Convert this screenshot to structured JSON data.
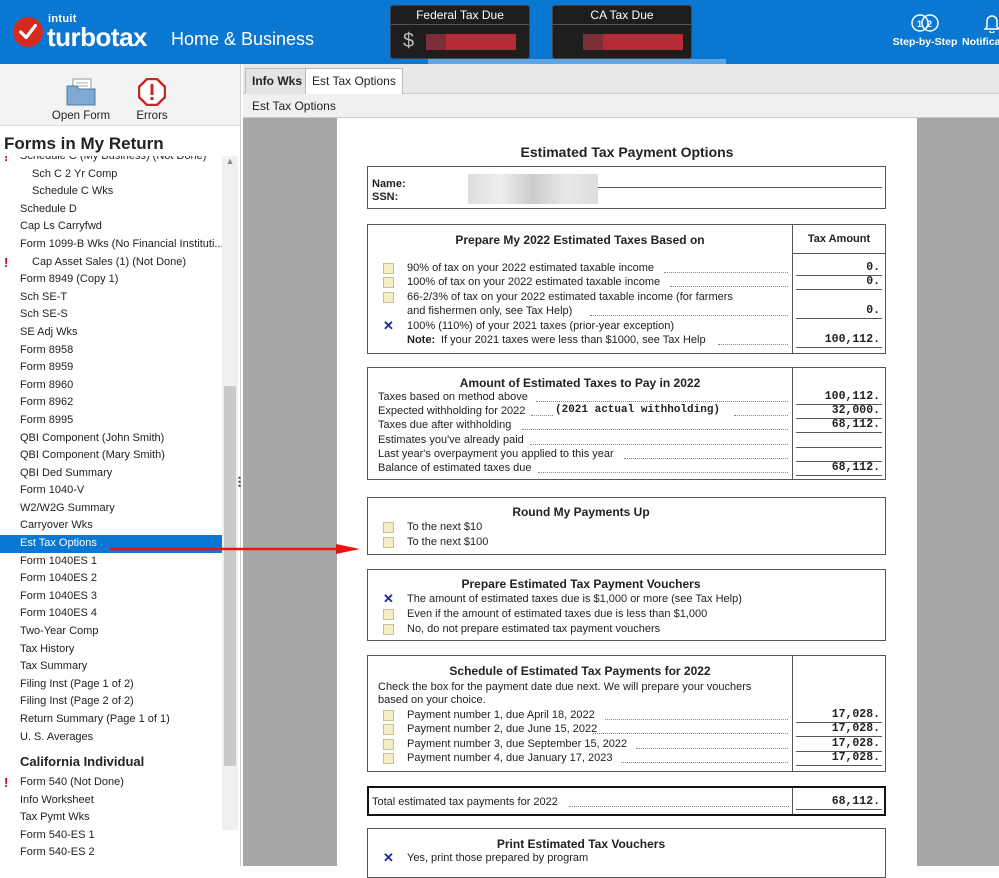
{
  "app": {
    "brand_top": "intuit",
    "brand": "turbotax",
    "edition": "Home & Business",
    "federal_label": "Federal Tax Due",
    "federal_currency": "$",
    "ca_label": "CA Tax Due",
    "step_label": "Step-by-Step",
    "notif_label": "Notifica"
  },
  "toolbar": {
    "open_form": "Open Form",
    "errors": "Errors"
  },
  "sidebar": {
    "title": "Forms in My Return",
    "items": [
      {
        "label": "Schedule C (My Business) (Not Done)",
        "indent": false,
        "err": true
      },
      {
        "label": "Sch C 2 Yr Comp",
        "indent": true,
        "err": false
      },
      {
        "label": "Schedule C Wks",
        "indent": true,
        "err": false
      },
      {
        "label": "Schedule D",
        "indent": false,
        "err": false
      },
      {
        "label": "Cap Ls Carryfwd",
        "indent": false,
        "err": false
      },
      {
        "label": "Form 1099-B Wks (No Financial Instituti...",
        "indent": false,
        "err": false
      },
      {
        "label": "Cap Asset Sales (1) (Not Done)",
        "indent": true,
        "err": true
      },
      {
        "label": "Form 8949 (Copy 1)",
        "indent": false,
        "err": false
      },
      {
        "label": "Sch SE-T",
        "indent": false,
        "err": false
      },
      {
        "label": "Sch SE-S",
        "indent": false,
        "err": false
      },
      {
        "label": "SE Adj Wks",
        "indent": false,
        "err": false
      },
      {
        "label": "Form 8958",
        "indent": false,
        "err": false
      },
      {
        "label": "Form 8959",
        "indent": false,
        "err": false
      },
      {
        "label": "Form 8960",
        "indent": false,
        "err": false
      },
      {
        "label": "Form 8962",
        "indent": false,
        "err": false
      },
      {
        "label": "Form 8995",
        "indent": false,
        "err": false
      },
      {
        "label": "QBI Component (John Smith)",
        "indent": false,
        "err": false
      },
      {
        "label": "QBI Component (Mary Smith)",
        "indent": false,
        "err": false
      },
      {
        "label": "QBI Ded Summary",
        "indent": false,
        "err": false
      },
      {
        "label": "Form 1040-V",
        "indent": false,
        "err": false
      },
      {
        "label": "W2/W2G Summary",
        "indent": false,
        "err": false
      },
      {
        "label": "Carryover Wks",
        "indent": false,
        "err": false
      },
      {
        "label": "Est Tax Options",
        "indent": false,
        "err": false,
        "selected": true
      },
      {
        "label": "Form 1040ES 1",
        "indent": false,
        "err": false
      },
      {
        "label": "Form 1040ES 2",
        "indent": false,
        "err": false
      },
      {
        "label": "Form 1040ES 3",
        "indent": false,
        "err": false
      },
      {
        "label": "Form 1040ES 4",
        "indent": false,
        "err": false
      },
      {
        "label": "Two-Year Comp",
        "indent": false,
        "err": false
      },
      {
        "label": "Tax History",
        "indent": false,
        "err": false
      },
      {
        "label": "Tax Summary",
        "indent": false,
        "err": false
      },
      {
        "label": "Filing Inst (Page 1 of 2)",
        "indent": false,
        "err": false
      },
      {
        "label": "Filing Inst (Page 2 of 2)",
        "indent": false,
        "err": false
      },
      {
        "label": "Return Summary (Page 1 of 1)",
        "indent": false,
        "err": false
      },
      {
        "label": "U. S. Averages",
        "indent": false,
        "err": false
      }
    ],
    "ca_section": "California Individual",
    "ca_items": [
      {
        "label": "Form 540 (Not Done)",
        "err": true
      },
      {
        "label": "Info Worksheet",
        "err": false
      },
      {
        "label": "Tax Pymt Wks",
        "err": false
      },
      {
        "label": "Form 540-ES 1",
        "err": false
      },
      {
        "label": "Form 540-ES 2",
        "err": false
      }
    ]
  },
  "tabs": [
    {
      "label": "Info Wks",
      "active": false
    },
    {
      "label": "Est Tax Options",
      "active": true
    }
  ],
  "subheader": "Est Tax Options",
  "form": {
    "title": "Estimated Tax Payment Options",
    "name_label": "Name:",
    "ssn_label": "SSN:",
    "prepare": {
      "title": "Prepare My 2022 Estimated Taxes Based on",
      "col": "Tax Amount",
      "opt1": "90% of tax on your 2022 estimated taxable income",
      "opt1_amt": "0.",
      "opt2": "100% of tax on your 2022 estimated taxable income",
      "opt2_amt": "0.",
      "opt3a": "66-2/3% of tax on your 2022 estimated taxable income (for farmers",
      "opt3b": "and fishermen only, see Tax Help)",
      "opt3_amt": "0.",
      "opt4": "100% (110%) of your 2021 taxes (prior-year exception)",
      "note_label": "Note:",
      "note": "If your 2021 taxes were less than $1000, see Tax Help",
      "opt4_amt": "100,112."
    },
    "amount": {
      "title": "Amount of Estimated Taxes to Pay in 2022",
      "r1": "Taxes based on method above",
      "r1_amt": "100,112.",
      "r2": "Expected withholding for 2022",
      "r2_note": "(2021 actual withholding)",
      "r2_amt": "32,000.",
      "r3": "Taxes due after withholding",
      "r3_amt": "68,112.",
      "r4": "Estimates you've already paid",
      "r5": "Last year's overpayment you applied to this year",
      "r6": "Balance of estimated taxes due",
      "r6_amt": "68,112."
    },
    "round": {
      "title": "Round My Payments Up",
      "o1": "To the next $10",
      "o2": "To the next $100"
    },
    "vouchers": {
      "title": "Prepare Estimated Tax Payment Vouchers",
      "o1": "The amount of estimated taxes due is $1,000 or more (see Tax Help)",
      "o2": "Even if the amount of estimated taxes due is less than $1,000",
      "o3": "No, do not prepare estimated tax payment vouchers"
    },
    "schedule": {
      "title": "Schedule of Estimated Tax Payments for 2022",
      "desc1": "Check the box for the payment date due next. We will prepare your vouchers",
      "desc2": "based on your choice.",
      "p1": "Payment number 1, due April 18, 2022",
      "p1_amt": "17,028.",
      "p2": "Payment number 2, due June 15, 2022",
      "p2_amt": "17,028.",
      "p3": "Payment number 3, due September 15, 2022",
      "p3_amt": "17,028.",
      "p4": "Payment number 4, due January 17, 2023",
      "p4_amt": "17,028."
    },
    "total": {
      "label": "Total estimated tax payments for 2022",
      "amt": "68,112."
    },
    "print": {
      "title": "Print Estimated Tax Vouchers",
      "o1": "Yes, print those prepared by program"
    }
  }
}
